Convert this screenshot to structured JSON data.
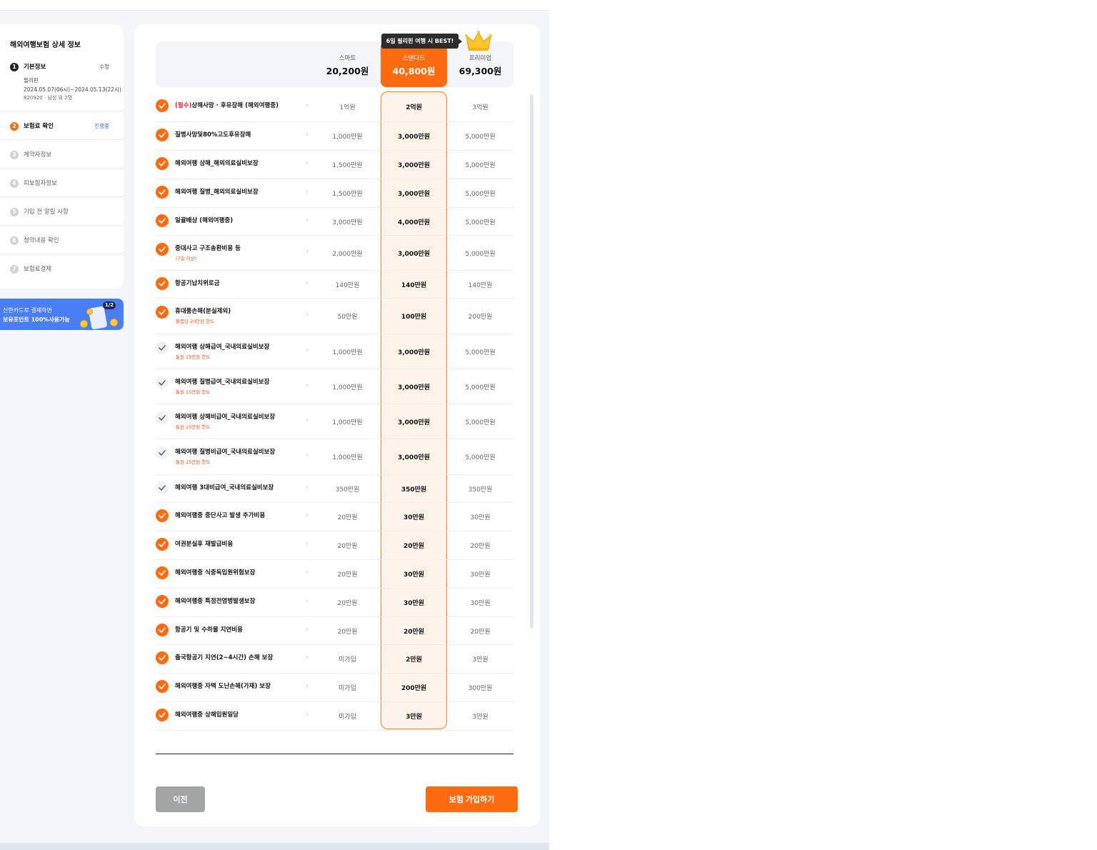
{
  "sidebar": {
    "title": "해외여행보험 상세 정보",
    "steps": [
      {
        "num": "1",
        "label": "기본정보",
        "tag": "수정"
      },
      {
        "num": "2",
        "label": "보험료 확인",
        "tag": "진행중"
      },
      {
        "num": "3",
        "label": "계약자정보",
        "tag": ""
      },
      {
        "num": "4",
        "label": "피보험자정보",
        "tag": ""
      },
      {
        "num": "5",
        "label": "기입 전 알릴 사항",
        "tag": ""
      },
      {
        "num": "6",
        "label": "청약내용 확인",
        "tag": ""
      },
      {
        "num": "7",
        "label": "보험료결제",
        "tag": ""
      }
    ],
    "detail": {
      "destination": "필리핀",
      "period": "2024.05.07(06시)~2024.05.13(22시)",
      "insured": "820920 · 남성 외 2명"
    }
  },
  "promo": {
    "line1": "신한카드로 결제하면",
    "line2": "보유포인트 100%사용가능",
    "badge": "1/2"
  },
  "plans": [
    {
      "name": "스마트",
      "price": "20,200원"
    },
    {
      "name": "스탠다드",
      "price": "40,800원"
    },
    {
      "name": "프리미엄",
      "price": "69,300원"
    }
  ],
  "best_tip": "6일 필리핀 여행 시 BEST!",
  "rows": [
    {
      "req": "(필수)",
      "name": "상해사망 · 후유장해 (해외여행중)",
      "sub": "",
      "checked": true,
      "values": [
        "1억원",
        "2억원",
        "3억원"
      ]
    },
    {
      "req": "",
      "name": "질병사망및80%고도후유장해",
      "sub": "",
      "checked": true,
      "values": [
        "1,000만원",
        "3,000만원",
        "5,000만원"
      ]
    },
    {
      "req": "",
      "name": "해외여행 상해_해외의료실비보장",
      "sub": "",
      "checked": true,
      "values": [
        "1,500만원",
        "3,000만원",
        "5,000만원"
      ]
    },
    {
      "req": "",
      "name": "해외여행 질병_해외의료실비보장",
      "sub": "",
      "checked": true,
      "values": [
        "1,500만원",
        "3,000만원",
        "5,000만원"
      ]
    },
    {
      "req": "",
      "name": "일괄배상 (해외여행중)",
      "sub": "",
      "checked": true,
      "values": [
        "3,000만원",
        "4,000만원",
        "5,000만원"
      ]
    },
    {
      "req": "",
      "name": "중대사고 구조송환비용 등",
      "sub": "(7일 이상)",
      "checked": true,
      "values": [
        "2,000만원",
        "3,000만원",
        "5,000만원"
      ]
    },
    {
      "req": "",
      "name": "항공기납치위로금",
      "sub": "",
      "checked": true,
      "values": [
        "140만원",
        "140만원",
        "140만원"
      ]
    },
    {
      "req": "",
      "name": "휴대품손해(분실제외)",
      "sub": "물품당 20만원 한도",
      "checked": true,
      "values": [
        "50만원",
        "100만원",
        "200만원"
      ]
    },
    {
      "req": "",
      "name": "해외여행 상해급여_국내의료실비보장",
      "sub": "통원 15만원 한도",
      "checked": false,
      "values": [
        "1,000만원",
        "3,000만원",
        "5,000만원"
      ]
    },
    {
      "req": "",
      "name": "해외여행 질병급여_국내의료실비보장",
      "sub": "통원 15만원 한도",
      "checked": false,
      "values": [
        "1,000만원",
        "3,000만원",
        "5,000만원"
      ]
    },
    {
      "req": "",
      "name": "해외여행 상해비급여_국내의료실비보장",
      "sub": "통원 15만원 한도",
      "checked": false,
      "values": [
        "1,000만원",
        "3,000만원",
        "5,000만원"
      ]
    },
    {
      "req": "",
      "name": "해외여행 질병비급여_국내의료실비보장",
      "sub": "통원 15만원 한도",
      "checked": false,
      "values": [
        "1,000만원",
        "3,000만원",
        "5,000만원"
      ]
    },
    {
      "req": "",
      "name": "해외여행 3대비급여_국내의료실비보장",
      "sub": "",
      "checked": false,
      "values": [
        "350만원",
        "350만원",
        "350만원"
      ]
    },
    {
      "req": "",
      "name": "해외여행중 중단사고 발생 추가비용",
      "sub": "",
      "checked": true,
      "values": [
        "20만원",
        "30만원",
        "30만원"
      ]
    },
    {
      "req": "",
      "name": "여권분실후 재발급비용",
      "sub": "",
      "checked": true,
      "values": [
        "20만원",
        "20만원",
        "20만원"
      ]
    },
    {
      "req": "",
      "name": "해외여행중 식중독입원위험보장",
      "sub": "",
      "checked": true,
      "values": [
        "20만원",
        "30만원",
        "30만원"
      ]
    },
    {
      "req": "",
      "name": "해외여행중 특정전염병발생보장",
      "sub": "",
      "checked": true,
      "values": [
        "20만원",
        "30만원",
        "30만원"
      ]
    },
    {
      "req": "",
      "name": "항공기 및 수하물 지연비용",
      "sub": "",
      "checked": true,
      "values": [
        "20만원",
        "20만원",
        "20만원"
      ]
    },
    {
      "req": "",
      "name": "출국항공기 지연(2~4시간) 손해 보장",
      "sub": "",
      "checked": true,
      "values": [
        "미가입",
        "2만원",
        "3만원"
      ]
    },
    {
      "req": "",
      "name": "해외여행중 자택 도난손해(가재) 보장",
      "sub": "",
      "checked": true,
      "values": [
        "미가입",
        "200만원",
        "300만원"
      ]
    },
    {
      "req": "",
      "name": "해외여행중 상해입원일당",
      "sub": "",
      "checked": true,
      "values": [
        "미가입",
        "3만원",
        "3만원"
      ]
    }
  ],
  "buttons": {
    "prev": "이전",
    "join": "보험 가입하기"
  },
  "colors": {
    "accent": "#ff6b10",
    "promo": "#4a7ef7",
    "required": "#e8282b"
  },
  "icons": {
    "check": "check-icon",
    "arrow": "chevron-right-icon",
    "crown": "crown-icon"
  }
}
